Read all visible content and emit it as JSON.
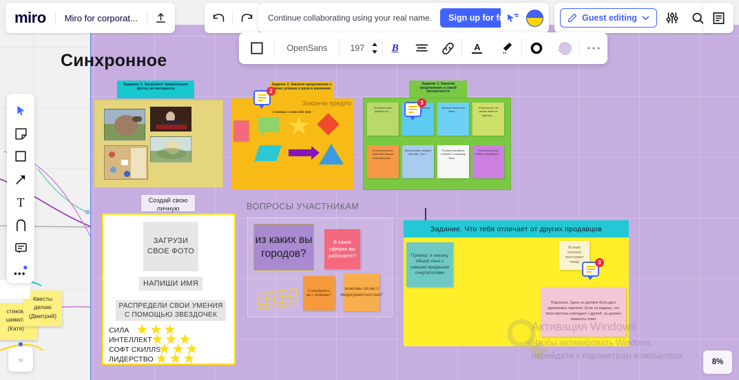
{
  "app": {
    "logo": "miro",
    "board_title": "Miro for corporat..."
  },
  "topbar": {
    "upload_icon": "upload-icon",
    "undo_icon": "undo-icon",
    "redo_icon": "redo-icon",
    "promo_text": "Continue collaborating using your real name.",
    "signup_label": "Sign up for free",
    "presentation_icon": "presentation-cursor-icon",
    "avatar_name": "user-avatar",
    "guest_label": "Guest editing",
    "guest_icon": "pencil-icon",
    "chevron_icon": "chevron-down-icon",
    "settings_icon": "sliders-icon",
    "search_icon": "search-icon",
    "notes_icon": "document-icon"
  },
  "format_toolbar": {
    "shape_icon": "square-icon",
    "font_family": "OpenSans",
    "font_size": "197",
    "stepper_icon": "stepper-updown-icon",
    "bold_label": "B",
    "align_icon": "align-icon",
    "link_icon": "link-icon",
    "text_color_label": "A",
    "highlight_icon": "marker-icon",
    "border_icon": "circle-outline-icon",
    "fill_icon": "fill-swatch-icon",
    "more_icon": "more-horizontal-icon"
  },
  "left_toolbar": {
    "items": [
      {
        "name": "select-tool",
        "icon": "cursor-icon"
      },
      {
        "name": "sticky-note-tool",
        "icon": "sticky-note-icon"
      },
      {
        "name": "shape-tool",
        "icon": "square-icon"
      },
      {
        "name": "connector-tool",
        "icon": "arrow-icon"
      },
      {
        "name": "text-tool",
        "icon": "text-t-icon"
      },
      {
        "name": "pen-tool",
        "icon": "pen-icon"
      },
      {
        "name": "comment-tool",
        "icon": "comment-icon"
      },
      {
        "name": "more-tools",
        "icon": "more-dots-icon"
      }
    ]
  },
  "canvas": {
    "board_heading": "Синхронное",
    "zoom_level": "8%",
    "collapse_icon": "chevron-double-right-icon",
    "task1": {
      "ribbon": "Задание 1. Загрузите прикольную фотку из интернета",
      "ribbon_color": "#19c7cf"
    },
    "task2": {
      "ribbon": "Задание 2. Закончи предложение о своих успехах и роли в компании",
      "ribbon_color": "#f7ba16",
      "panel_heading": "Закончи предло",
      "panel_sub": "2 важных слова обо мне :",
      "comment_count": "2"
    },
    "task3": {
      "ribbon": "Задание 3. Закончи предложение о своей экспертности",
      "ribbon_color": "#7ac943",
      "comment_count": "3",
      "notes": [
        {
          "text": "Я люблю свою работу за ...",
          "color": "#b9d96a"
        },
        {
          "text": "Я помогаю нашей компании ...",
          "color": "#5ecbf2"
        },
        {
          "text": "Важнее всего для меня ...",
          "color": "#6fd0f5"
        },
        {
          "text": "Я ценность на рынке знаю за работу ...",
          "color": "#cfe06a"
        },
        {
          "text": "Я больше всего помогаю нашим покупателям ...",
          "color": "#f79845"
        },
        {
          "text": "Мои коллеги скажут обо мне, что ...",
          "color": "#a8cbf0"
        },
        {
          "text": "Я умею находить подход к сложному делу ...",
          "color": "#f7f7f7"
        },
        {
          "text": "Я больше всего люблю на работе ...",
          "color": "#cc7fe0"
        }
      ]
    },
    "personal_card": {
      "label": "Создай свою личную карточку",
      "photo_placeholder": "ЗАГРУЗИ СВОЕ ФОТО",
      "name_placeholder": "НАПИШИ ИМЯ",
      "skills_header": "РАСПРЕДЕЛИ СВОИ УМЕНИЯ С ПОМОЩЬЮ ЗВЕЗДОЧЕК",
      "skills": [
        {
          "label": "СИЛА",
          "stars": 3
        },
        {
          "label": "ИНТЕЛЛЕКТ",
          "stars": 3
        },
        {
          "label": "СОФТ СКИЛЛЅ",
          "stars": 3
        },
        {
          "label": "ЛИДЕРСТВО",
          "stars": 3
        }
      ]
    },
    "questions": {
      "title": "ВОПРОСЫ УЧАСТНИКАМ",
      "big_card": "из каких вы городов?",
      "stickies": [
        {
          "text": "В каких сферах вы работаете?",
          "color": "#f4697e"
        },
        {
          "text": "Сталкивались вы с фейками?",
          "color": "#f79a3c"
        },
        {
          "text": "знакомы ли вы с медиграмотностью?",
          "color": "#f9ae4e"
        }
      ]
    },
    "right_task": {
      "ribbon": "Задание. Что тебя отличает от других продавцов",
      "example_note": "Пример: я нахожу общий язык с самыми вредными покупателями",
      "answer_note": "Я знаю сколько прослужит товар",
      "answer_comment_count": "3",
      "hint_note": "Подсказка. Здесь не должно быть двух одинаковых карточек. Если ты видишь, что твоя карточка совпадает с другой, ты должен поменять ответ"
    },
    "left_stickies": [
      {
        "text": "Квесты делаю (Дмитрий)"
      },
      {
        "text": "стиком шивать (Катя)"
      }
    ]
  },
  "watermark": {
    "title": "Активация Windows",
    "subtitle": "Чтобы активировать Windows, перейдите к параметрам компьютера."
  }
}
